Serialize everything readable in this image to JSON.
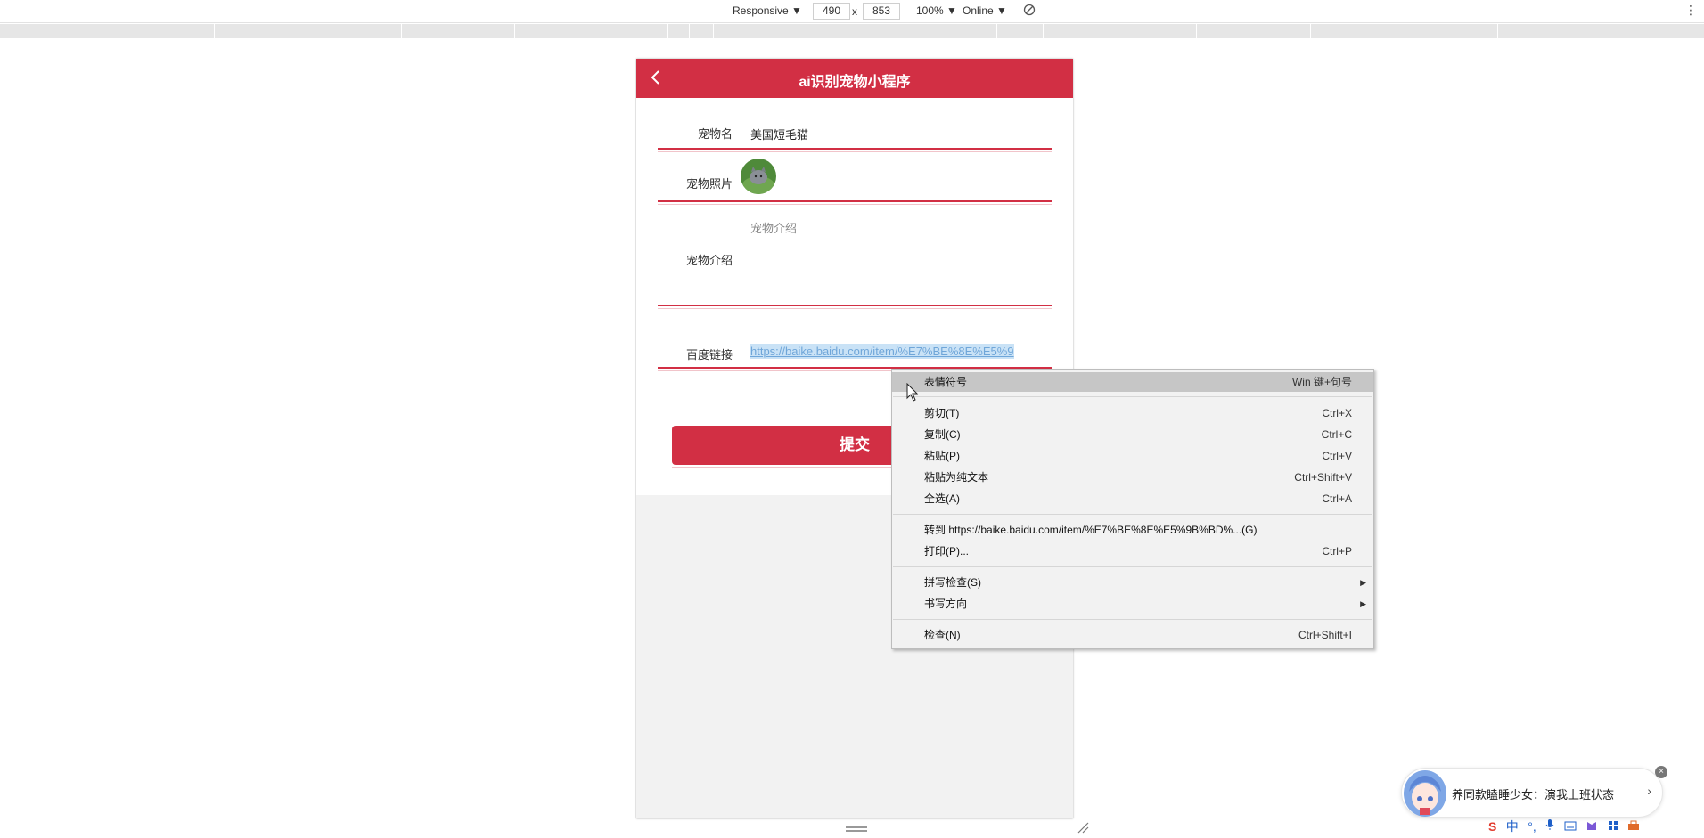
{
  "devtools": {
    "device": "Responsive ▼",
    "width": "490",
    "times": "x",
    "height": "853",
    "zoom": "100% ▼",
    "network": "Online ▼"
  },
  "app": {
    "title": "ai识别宠物小程序",
    "form": {
      "pet_name_label": "宠物名",
      "pet_name_value": "美国短毛猫",
      "pet_photo_label": "宠物照片",
      "pet_intro_label": "宠物介绍",
      "pet_intro_placeholder": "宠物介绍",
      "baidu_link_label": "百度链接",
      "baidu_link_value": "https://baike.baidu.com/item/%E7%BE%8E%E5%9"
    },
    "submit_label": "提交"
  },
  "context_menu": {
    "items": [
      {
        "label": "表情符号",
        "shortcut": "Win 键+句号",
        "highlighted": true
      },
      {
        "label": "剪切(T)",
        "shortcut": "Ctrl+X"
      },
      {
        "label": "复制(C)",
        "shortcut": "Ctrl+C"
      },
      {
        "label": "粘贴(P)",
        "shortcut": "Ctrl+V"
      },
      {
        "label": "粘贴为纯文本",
        "shortcut": "Ctrl+Shift+V"
      },
      {
        "label": "全选(A)",
        "shortcut": "Ctrl+A"
      },
      {
        "label": "转到 https://baike.baidu.com/item/%E7%BE%8E%E5%9B%BD%...(G)",
        "shortcut": ""
      },
      {
        "label": "打印(P)...",
        "shortcut": "Ctrl+P"
      },
      {
        "label": "拼写检查(S)",
        "shortcut": ""
      },
      {
        "label": "书写方向",
        "shortcut": ""
      },
      {
        "label": "检查(N)",
        "shortcut": "Ctrl+Shift+I"
      }
    ]
  },
  "assistant": {
    "message": "养同款瞌睡少女：演我上班状态",
    "close": "×",
    "chevron": "›"
  },
  "tray": {
    "ime_mode": "中",
    "punct": "°,"
  },
  "colors": {
    "brand_red": "#d22f44",
    "menu_bg": "#f2f2f2",
    "menu_highlight": "#c6c6c6",
    "link_selection": "#c9e2f6"
  }
}
